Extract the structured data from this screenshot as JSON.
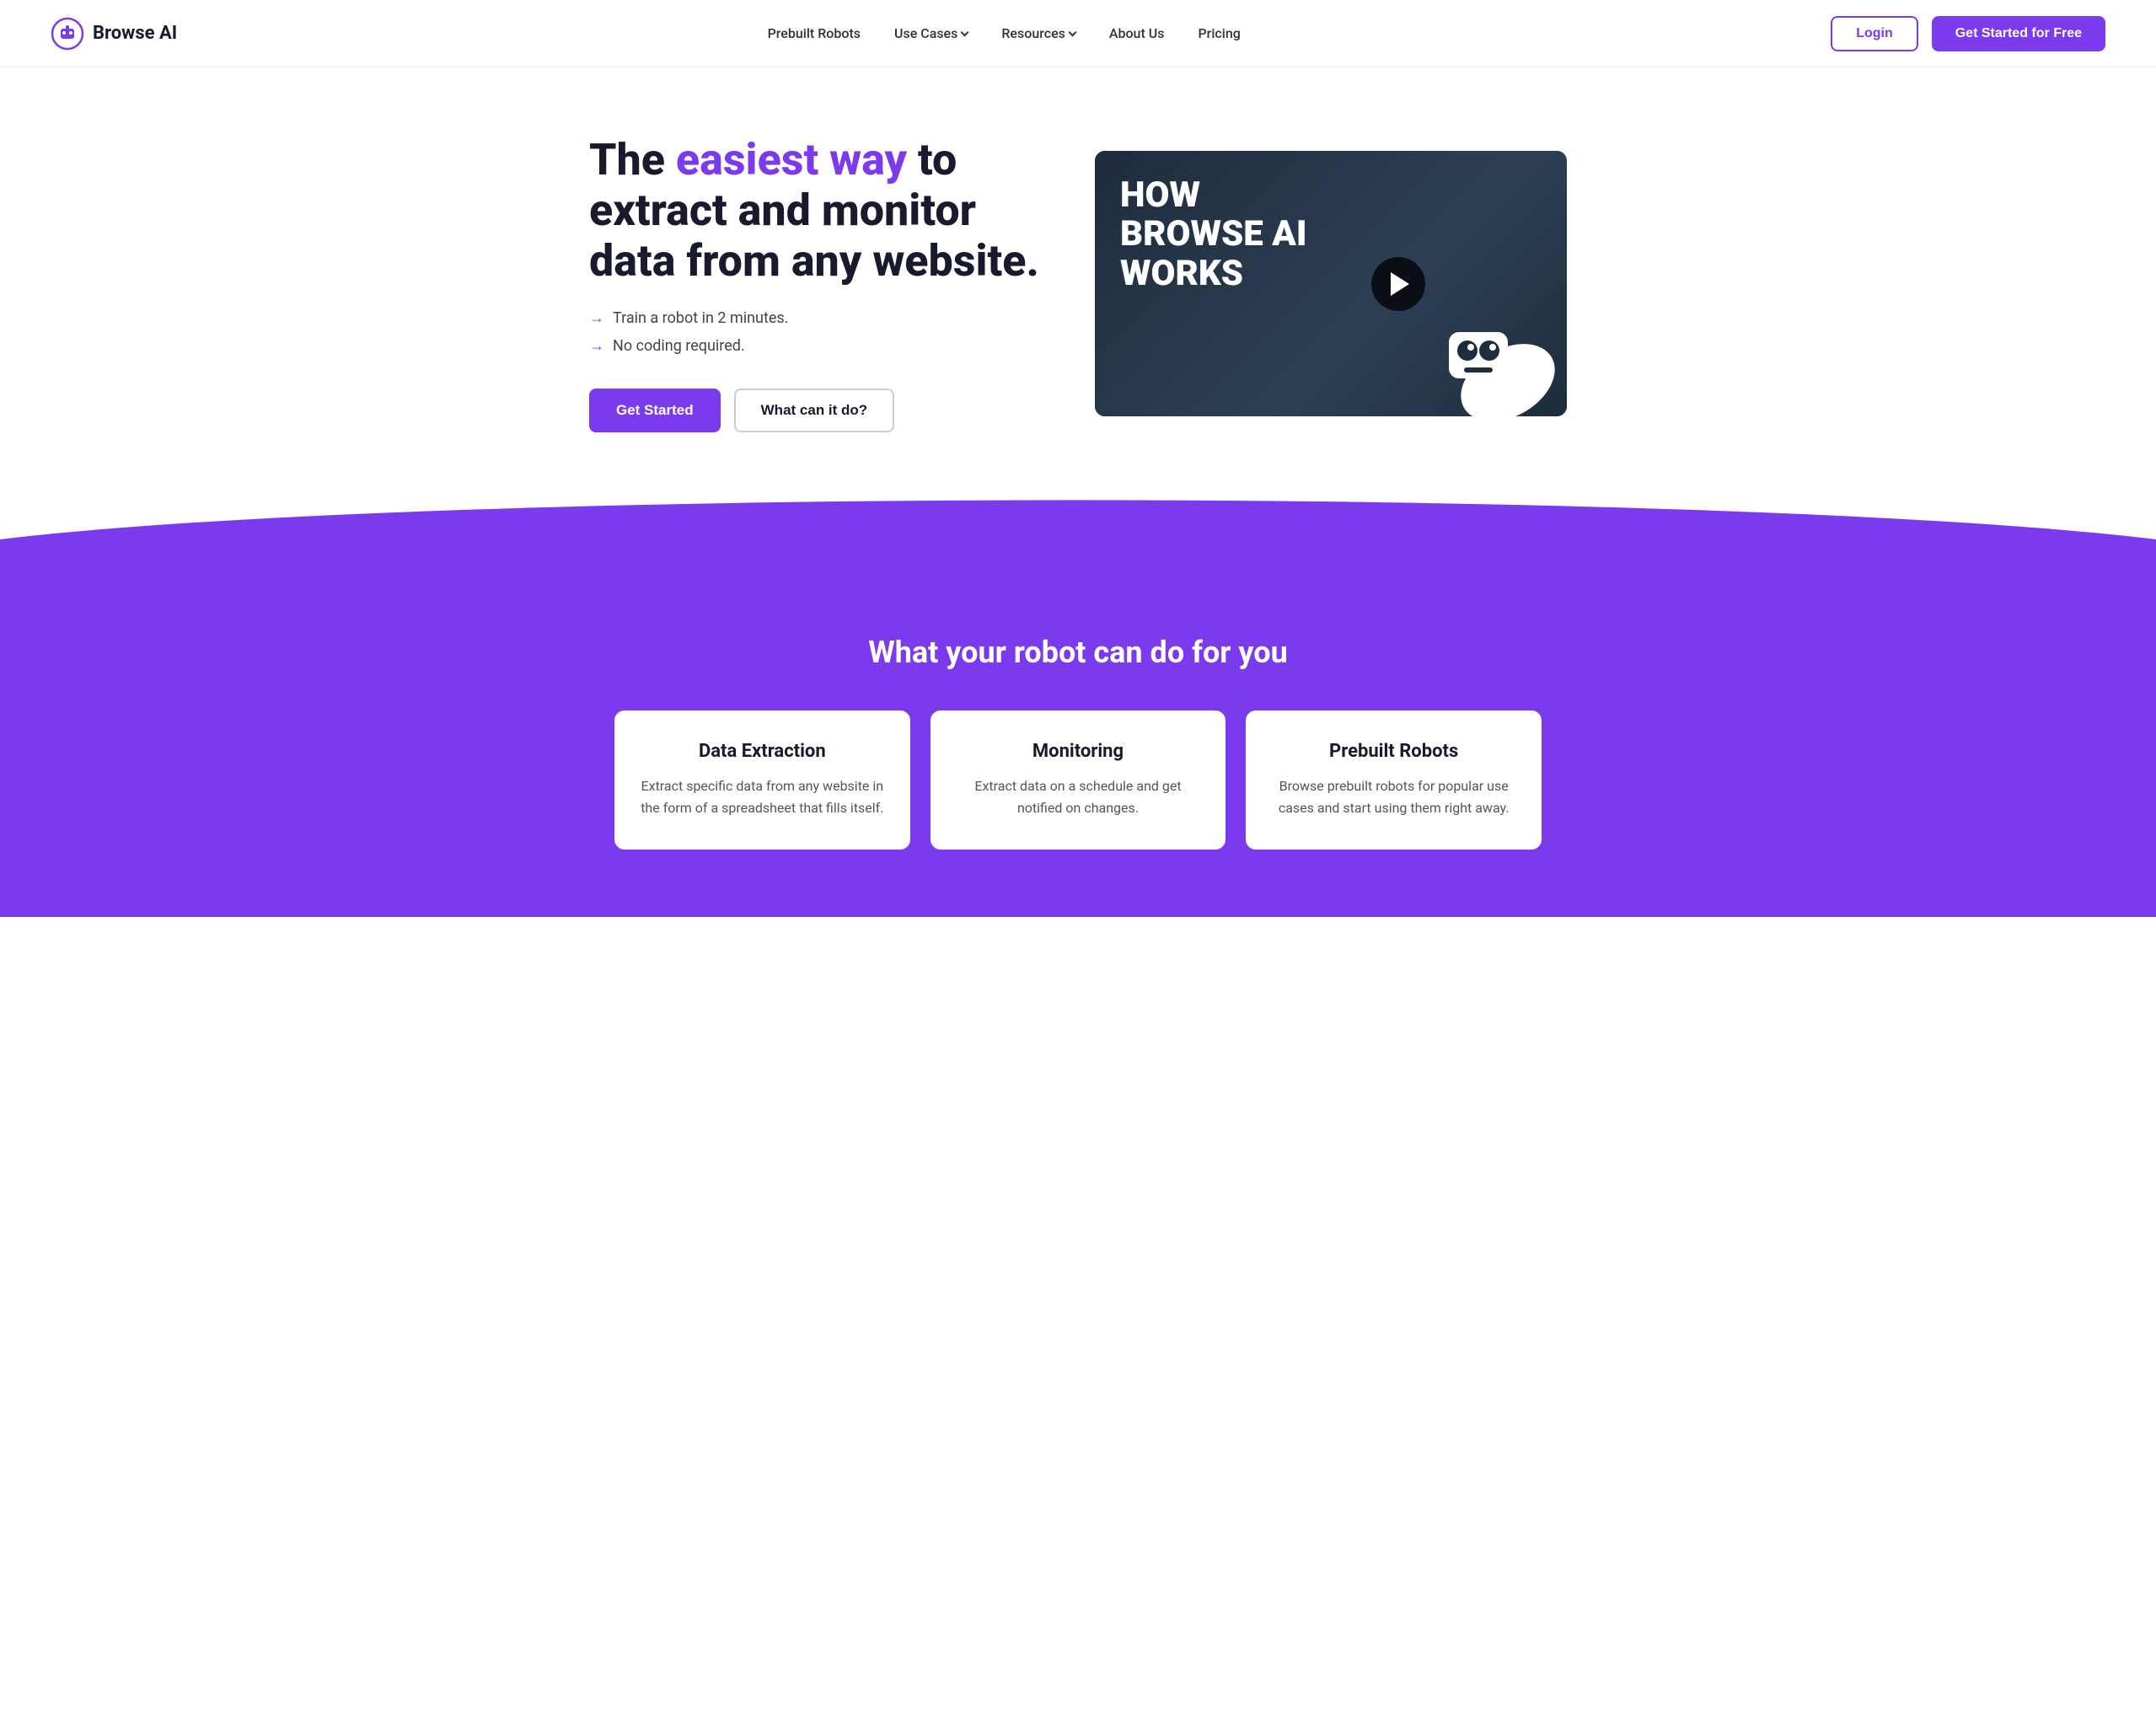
{
  "brand": {
    "name": "Browse AI",
    "logo_alt": "Browse AI Logo"
  },
  "navbar": {
    "links": [
      {
        "label": "Prebuilt Robots",
        "has_dropdown": false
      },
      {
        "label": "Use Cases",
        "has_dropdown": true
      },
      {
        "label": "Resources",
        "has_dropdown": true
      },
      {
        "label": "About Us",
        "has_dropdown": false
      },
      {
        "label": "Pricing",
        "has_dropdown": false
      }
    ],
    "login_label": "Login",
    "get_started_label": "Get Started for Free"
  },
  "hero": {
    "title_part1": "The ",
    "title_highlight": "easiest way",
    "title_part2": " to extract and monitor data from any website.",
    "features": [
      "Train a robot in 2 minutes.",
      "No coding required."
    ],
    "btn_get_started": "Get Started",
    "btn_what_can": "What can it do?"
  },
  "video": {
    "line1": "HOW",
    "line2": "BROWSE AI",
    "line3": "WORKS"
  },
  "purple_section": {
    "title": "What your robot can do for you",
    "cards": [
      {
        "title": "Data Extraction",
        "description": "Extract specific data from any website in the form of a spreadsheet that fills itself."
      },
      {
        "title": "Monitoring",
        "description": "Extract data on a schedule and get notified on changes."
      },
      {
        "title": "Prebuilt Robots",
        "description": "Browse prebuilt robots for popular use cases and start using them right away."
      }
    ]
  }
}
